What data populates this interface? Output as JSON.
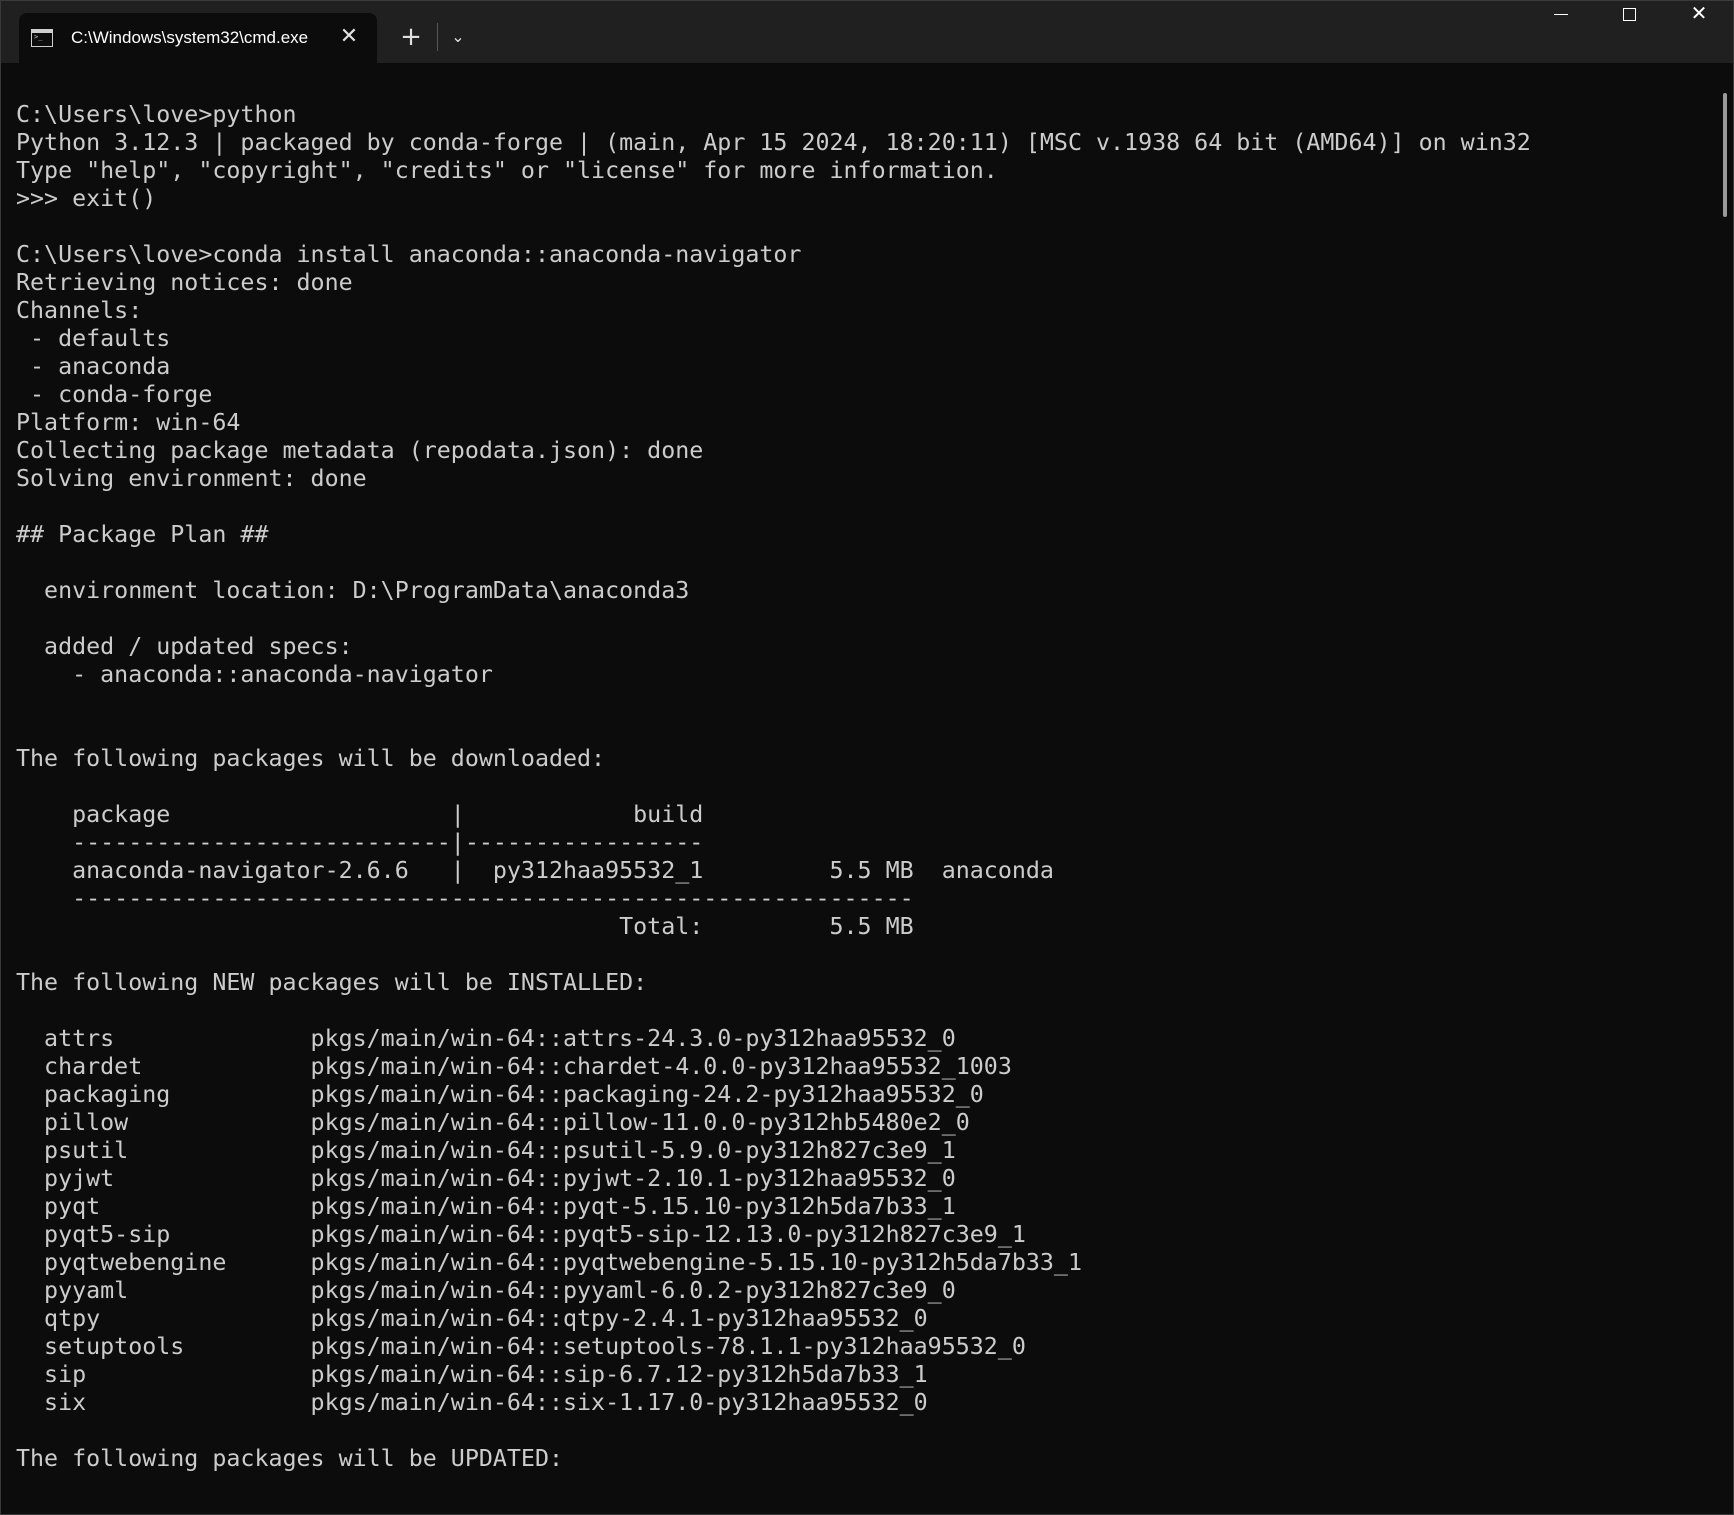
{
  "tab": {
    "title": "C:\\Windows\\system32\\cmd.exe",
    "icon": "cmd-icon",
    "close": "✕"
  },
  "titlebar": {
    "new_tab": "+",
    "dropdown": "⌄",
    "close": "✕"
  },
  "terminal": {
    "lines": [
      "C:\\Users\\love>python",
      "Python 3.12.3 | packaged by conda-forge | (main, Apr 15 2024, 18:20:11) [MSC v.1938 64 bit (AMD64)] on win32",
      "Type \"help\", \"copyright\", \"credits\" or \"license\" for more information.",
      ">>> exit()",
      "",
      "C:\\Users\\love>conda install anaconda::anaconda-navigator",
      "Retrieving notices: done",
      "Channels:",
      " - defaults",
      " - anaconda",
      " - conda-forge",
      "Platform: win-64",
      "Collecting package metadata (repodata.json): done",
      "Solving environment: done",
      "",
      "## Package Plan ##",
      "",
      "  environment location: D:\\ProgramData\\anaconda3",
      "",
      "  added / updated specs:",
      "    - anaconda::anaconda-navigator",
      "",
      "",
      "The following packages will be downloaded:",
      "",
      "    package                    |            build",
      "    ---------------------------|-----------------",
      "    anaconda-navigator-2.6.6   |  py312haa95532_1         5.5 MB  anaconda",
      "    ------------------------------------------------------------",
      "                                           Total:         5.5 MB",
      "",
      "The following NEW packages will be INSTALLED:",
      "",
      "  attrs              pkgs/main/win-64::attrs-24.3.0-py312haa95532_0",
      "  chardet            pkgs/main/win-64::chardet-4.0.0-py312haa95532_1003",
      "  packaging          pkgs/main/win-64::packaging-24.2-py312haa95532_0",
      "  pillow             pkgs/main/win-64::pillow-11.0.0-py312hb5480e2_0",
      "  psutil             pkgs/main/win-64::psutil-5.9.0-py312h827c3e9_1",
      "  pyjwt              pkgs/main/win-64::pyjwt-2.10.1-py312haa95532_0",
      "  pyqt               pkgs/main/win-64::pyqt-5.15.10-py312h5da7b33_1",
      "  pyqt5-sip          pkgs/main/win-64::pyqt5-sip-12.13.0-py312h827c3e9_1",
      "  pyqtwebengine      pkgs/main/win-64::pyqtwebengine-5.15.10-py312h5da7b33_1",
      "  pyyaml             pkgs/main/win-64::pyyaml-6.0.2-py312h827c3e9_0",
      "  qtpy               pkgs/main/win-64::qtpy-2.4.1-py312haa95532_0",
      "  setuptools         pkgs/main/win-64::setuptools-78.1.1-py312haa95532_0",
      "  sip                pkgs/main/win-64::sip-6.7.12-py312h5da7b33_1",
      "  six                pkgs/main/win-64::six-1.17.0-py312haa95532_0",
      "",
      "The following packages will be UPDATED:"
    ]
  },
  "colors": {
    "background": "#0c0c0c",
    "titlebar": "#202020",
    "text": "#cccccc"
  }
}
